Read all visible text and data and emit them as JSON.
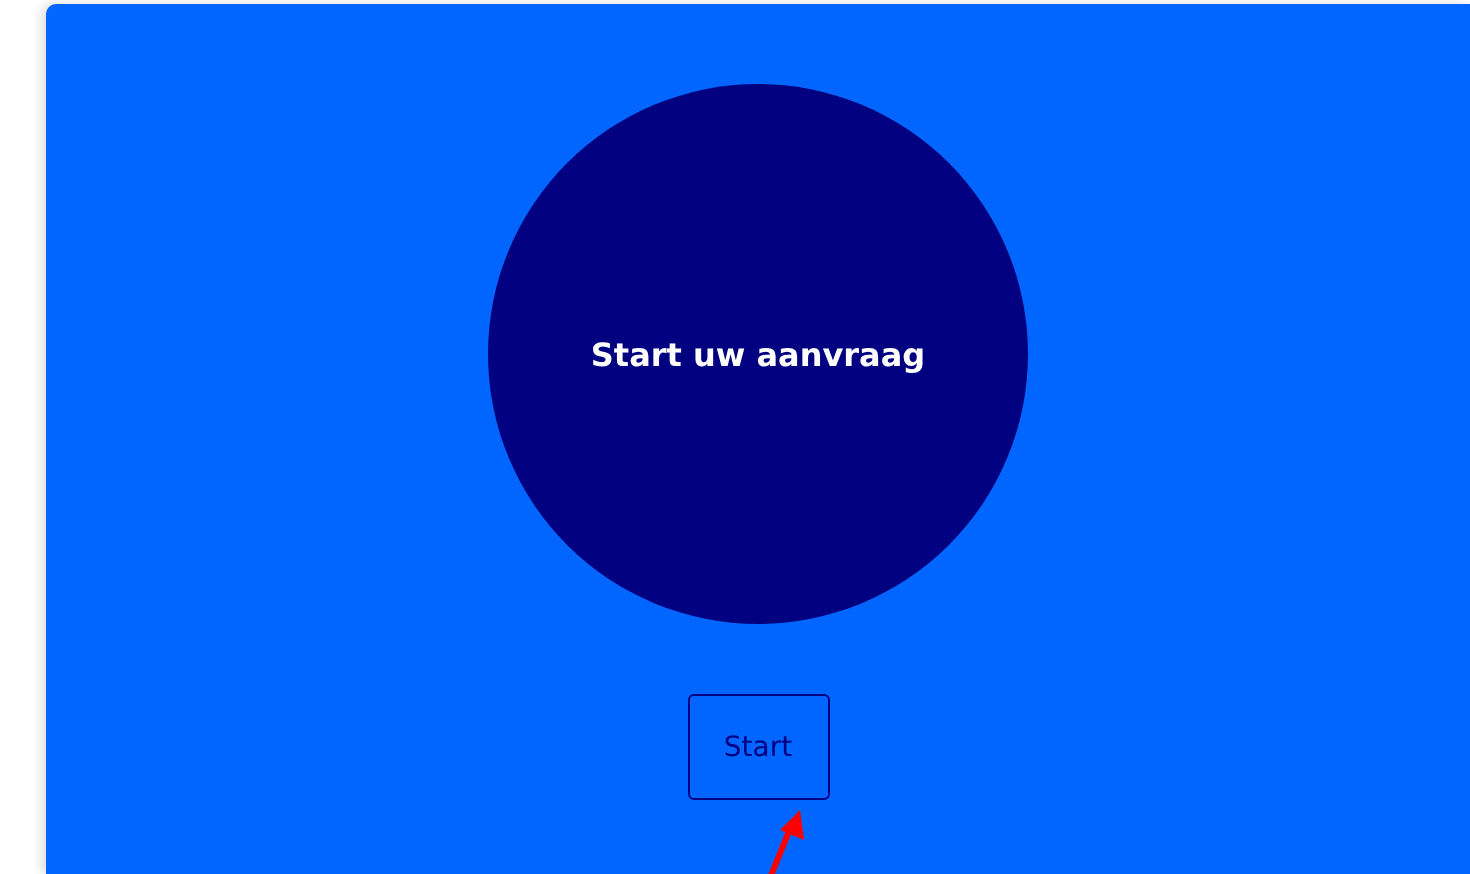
{
  "circle": {
    "title": "Start uw aanvraag"
  },
  "button": {
    "label": "Start"
  }
}
